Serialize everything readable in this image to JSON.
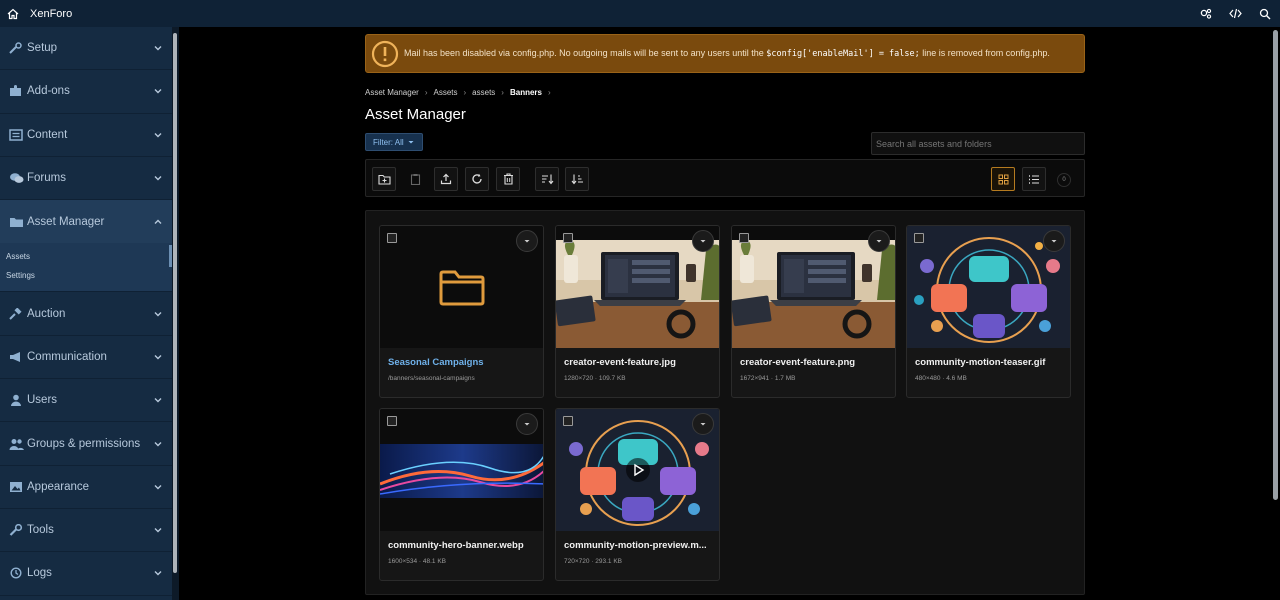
{
  "topbar": {
    "brand": "XenForo",
    "icons": [
      "home-icon",
      "settings-cogs-icon",
      "code-icon",
      "search-icon"
    ]
  },
  "sidebar": {
    "items": [
      {
        "label": "Setup",
        "icon": "wrench-cog-icon"
      },
      {
        "label": "Add-ons",
        "icon": "puzzle-icon"
      },
      {
        "label": "Content",
        "icon": "document-icon"
      },
      {
        "label": "Forums",
        "icon": "comments-icon"
      },
      {
        "label": "Asset Manager",
        "icon": "folder-icon"
      },
      {
        "label": "Auction",
        "icon": "gavel-icon"
      },
      {
        "label": "Communication",
        "icon": "megaphone-icon"
      },
      {
        "label": "Users",
        "icon": "user-icon"
      },
      {
        "label": "Groups & permissions",
        "icon": "users-icon"
      },
      {
        "label": "Appearance",
        "icon": "image-icon"
      },
      {
        "label": "Tools",
        "icon": "wrench-icon"
      },
      {
        "label": "Logs",
        "icon": "history-icon"
      }
    ],
    "asset_subitems": [
      "Assets",
      "Settings"
    ]
  },
  "notice": {
    "text_before": "Mail has been disabled via config.php. No outgoing mails will be sent to any users until the",
    "code": "$config['enableMail'] = false;",
    "text_after": "line is removed from config.php."
  },
  "breadcrumb": [
    "Asset Manager",
    "Assets",
    "assets",
    "Banners"
  ],
  "page_title": "Asset Manager",
  "filter_label": "Filter: All",
  "search_placeholder": "Search all assets and folders",
  "selected_count": "0",
  "colors": {
    "accent": "#b57b20",
    "link": "#6fb1ea",
    "sidebar": "#152b42",
    "warning": "#7a4a0d"
  },
  "assets": [
    {
      "name": "Seasonal Campaigns",
      "meta": "/banners/seasonal-campaigns",
      "kind": "folder"
    },
    {
      "name": "creator-event-feature.jpg",
      "meta": "1280×720 · 109.7 KB",
      "kind": "photo"
    },
    {
      "name": "creator-event-feature.png",
      "meta": "1672×941 · 1.7 MB",
      "kind": "photo"
    },
    {
      "name": "community-motion-teaser.gif",
      "meta": "480×480 · 4.6 MB",
      "kind": "graphic"
    },
    {
      "name": "community-hero-banner.webp",
      "meta": "1600×534 · 48.1 KB",
      "kind": "banner"
    },
    {
      "name": "community-motion-preview.m...",
      "meta": "720×720 · 293.1 KB",
      "kind": "video"
    }
  ]
}
